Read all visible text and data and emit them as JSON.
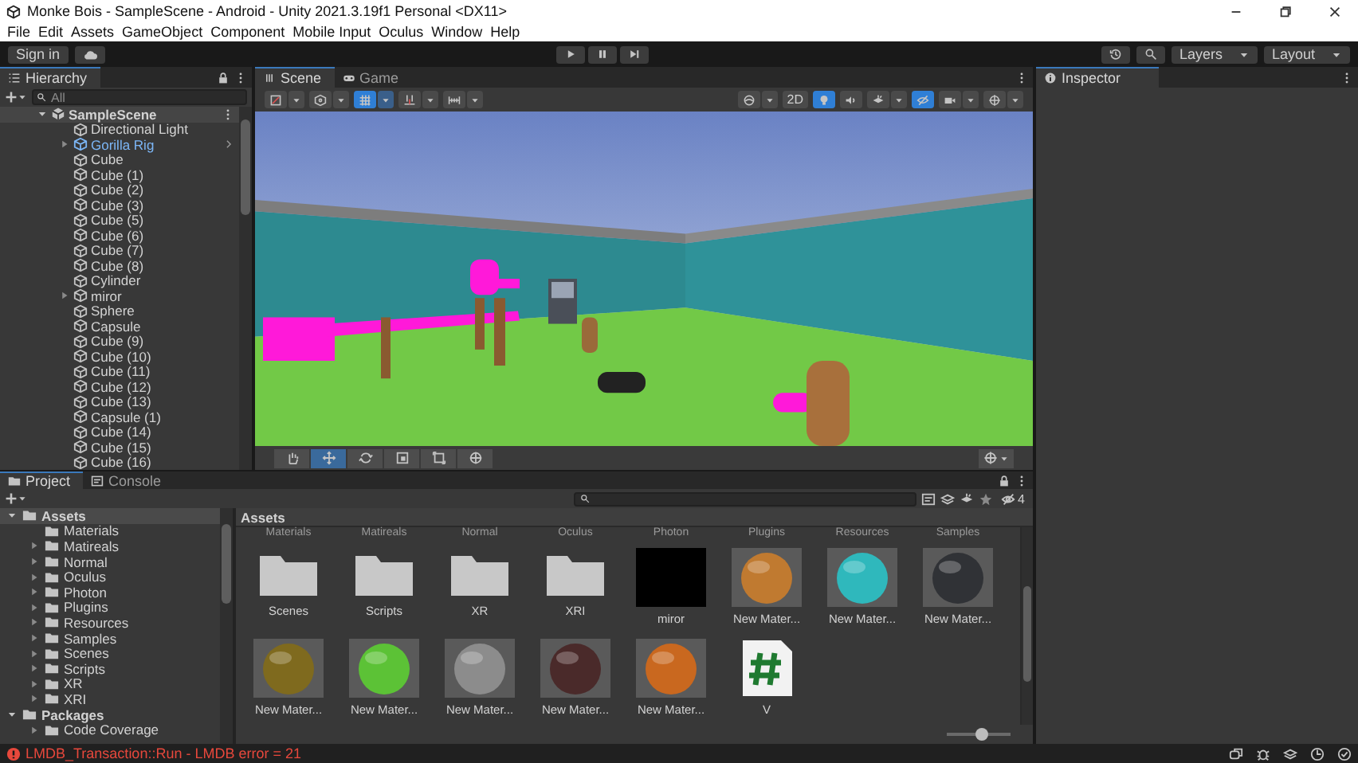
{
  "window": {
    "title": "Monke Bois - SampleScene - Android - Unity 2021.3.19f1 Personal <DX11>"
  },
  "menu": [
    "File",
    "Edit",
    "Assets",
    "GameObject",
    "Component",
    "Mobile Input",
    "Oculus",
    "Window",
    "Help"
  ],
  "toolbar": {
    "sign_in": "Sign in",
    "layers": "Layers",
    "layout": "Layout"
  },
  "hierarchy": {
    "title": "Hierarchy",
    "search": {
      "placeholder": "All"
    },
    "tree": [
      {
        "name": "SampleScene",
        "kind": "scene",
        "expandable": true,
        "expanded": true,
        "children": [
          {
            "name": "Directional Light",
            "kind": "object",
            "expandable": false
          },
          {
            "name": "Gorilla Rig",
            "kind": "prefab",
            "expandable": true,
            "expanded": false
          },
          {
            "name": "Cube",
            "kind": "object",
            "expandable": false
          },
          {
            "name": "Cube (1)",
            "kind": "object",
            "expandable": false
          },
          {
            "name": "Cube (2)",
            "kind": "object",
            "expandable": false
          },
          {
            "name": "Cube (3)",
            "kind": "object",
            "expandable": false
          },
          {
            "name": "Cube (5)",
            "kind": "object",
            "expandable": false
          },
          {
            "name": "Cube (6)",
            "kind": "object",
            "expandable": false
          },
          {
            "name": "Cube (7)",
            "kind": "object",
            "expandable": false
          },
          {
            "name": "Cube (8)",
            "kind": "object",
            "expandable": false
          },
          {
            "name": "Cylinder",
            "kind": "object",
            "expandable": false
          },
          {
            "name": "miror",
            "kind": "object",
            "expandable": true,
            "expanded": false
          },
          {
            "name": "Sphere",
            "kind": "object",
            "expandable": false
          },
          {
            "name": "Capsule",
            "kind": "object",
            "expandable": false
          },
          {
            "name": "Cube (9)",
            "kind": "object",
            "expandable": false
          },
          {
            "name": "Cube (10)",
            "kind": "object",
            "expandable": false
          },
          {
            "name": "Cube (11)",
            "kind": "object",
            "expandable": false
          },
          {
            "name": "Cube (12)",
            "kind": "object",
            "expandable": false
          },
          {
            "name": "Cube (13)",
            "kind": "object",
            "expandable": false
          },
          {
            "name": "Capsule (1)",
            "kind": "object",
            "expandable": false
          },
          {
            "name": "Cube (14)",
            "kind": "object",
            "expandable": false
          },
          {
            "name": "Cube (15)",
            "kind": "object",
            "expandable": false
          },
          {
            "name": "Cube (16)",
            "kind": "object",
            "expandable": false
          }
        ]
      }
    ]
  },
  "scene_view": {
    "tabs": [
      {
        "label": "Scene",
        "kind": "scene",
        "selected": true
      },
      {
        "label": "Game",
        "kind": "game",
        "selected": false
      }
    ],
    "toggles": [
      {
        "kind": "orientation",
        "on": false
      },
      {
        "kind": "pivot",
        "on": false
      },
      {
        "kind": "grid",
        "on": true
      },
      {
        "kind": "snap",
        "on": false
      },
      {
        "kind": "increment",
        "on": false
      },
      {
        "kind": "drawmode",
        "on": false
      },
      {
        "kind": "dimension",
        "label": "2D",
        "on": false
      },
      {
        "kind": "lighting",
        "on": true
      },
      {
        "kind": "audio",
        "on": false
      },
      {
        "kind": "effects",
        "on": false
      },
      {
        "kind": "visibility",
        "on": true
      },
      {
        "kind": "camera",
        "on": false
      },
      {
        "kind": "gizmos",
        "on": false
      }
    ],
    "tools": [
      {
        "kind": "hand",
        "selected": false
      },
      {
        "kind": "move",
        "selected": true
      },
      {
        "kind": "rotate",
        "selected": false
      },
      {
        "kind": "scale",
        "selected": false
      },
      {
        "kind": "rect",
        "selected": false
      },
      {
        "kind": "transform",
        "selected": false
      }
    ]
  },
  "project": {
    "tabs": [
      {
        "label": "Project",
        "kind": "project",
        "selected": true
      },
      {
        "label": "Console",
        "kind": "console",
        "selected": false
      }
    ],
    "tree": [
      {
        "name": "Assets",
        "expandable": true,
        "expanded": true,
        "selected": true,
        "children": [
          {
            "name": "Materials",
            "expandable": false,
            "selected": false
          },
          {
            "name": "Matireals",
            "expandable": true,
            "expanded": false,
            "selected": false
          },
          {
            "name": "Normal",
            "expandable": true,
            "expanded": false,
            "selected": false
          },
          {
            "name": "Oculus",
            "expandable": true,
            "expanded": false,
            "selected": false
          },
          {
            "name": "Photon",
            "expandable": true,
            "expanded": false,
            "selected": false
          },
          {
            "name": "Plugins",
            "expandable": true,
            "expanded": false,
            "selected": false
          },
          {
            "name": "Resources",
            "expandable": true,
            "expanded": false,
            "selected": false
          },
          {
            "name": "Samples",
            "expandable": true,
            "expanded": false,
            "selected": false
          },
          {
            "name": "Scenes",
            "expandable": true,
            "expanded": false,
            "selected": false
          },
          {
            "name": "Scripts",
            "expandable": true,
            "expanded": false,
            "selected": false
          },
          {
            "name": "XR",
            "expandable": true,
            "expanded": false,
            "selected": false
          },
          {
            "name": "XRI",
            "expandable": true,
            "expanded": false,
            "selected": false
          }
        ]
      },
      {
        "name": "Packages",
        "expandable": true,
        "expanded": true,
        "selected": false,
        "children": [
          {
            "name": "Code Coverage",
            "expandable": true,
            "expanded": false,
            "selected": false
          }
        ]
      }
    ],
    "hidden_count": "4",
    "breadcrumb": "Assets",
    "scrolled_labels": [
      "Materials",
      "Matireals",
      "Normal",
      "Oculus",
      "Photon",
      "Plugins",
      "Resources",
      "Samples"
    ],
    "assets": [
      {
        "name": "Scenes",
        "kind": "folder"
      },
      {
        "name": "Scripts",
        "kind": "folder"
      },
      {
        "name": "XR",
        "kind": "folder"
      },
      {
        "name": "XRI",
        "kind": "folder"
      },
      {
        "name": "miror",
        "kind": "texture"
      },
      {
        "name": "New Mater...",
        "kind": "material",
        "color": "#c07a30"
      },
      {
        "name": "New Mater...",
        "kind": "material",
        "color": "#2fb8bc"
      },
      {
        "name": "New Mater...",
        "kind": "material",
        "color": "#303236"
      },
      {
        "name": "New Mater...",
        "kind": "material",
        "color": "#7f6a1e"
      },
      {
        "name": "New Mater...",
        "kind": "material",
        "color": "#5cc236"
      },
      {
        "name": "New Mater...",
        "kind": "material",
        "color": "#8c8c8c"
      },
      {
        "name": "New Mater...",
        "kind": "material",
        "color": "#4a2a2a"
      },
      {
        "name": "New Mater...",
        "kind": "material",
        "color": "#c9681f"
      },
      {
        "name": "V",
        "kind": "script"
      }
    ],
    "zoom": {
      "level": 0.55
    }
  },
  "inspector": {
    "title": "Inspector"
  },
  "status_bar": {
    "message": "LMDB_Transaction::Run - LMDB error = 21"
  }
}
